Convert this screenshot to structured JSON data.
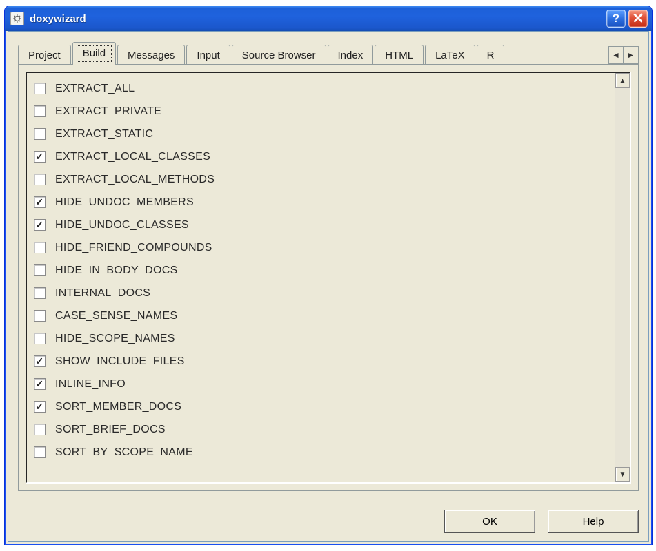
{
  "window": {
    "title": "doxywizard"
  },
  "tabs": [
    {
      "label": "Project",
      "active": false
    },
    {
      "label": "Build",
      "active": true
    },
    {
      "label": "Messages",
      "active": false
    },
    {
      "label": "Input",
      "active": false
    },
    {
      "label": "Source Browser",
      "active": false
    },
    {
      "label": "Index",
      "active": false
    },
    {
      "label": "HTML",
      "active": false
    },
    {
      "label": "LaTeX",
      "active": false
    },
    {
      "label": "R",
      "active": false
    }
  ],
  "options": [
    {
      "label": "EXTRACT_ALL",
      "checked": false
    },
    {
      "label": "EXTRACT_PRIVATE",
      "checked": false
    },
    {
      "label": "EXTRACT_STATIC",
      "checked": false
    },
    {
      "label": "EXTRACT_LOCAL_CLASSES",
      "checked": true
    },
    {
      "label": "EXTRACT_LOCAL_METHODS",
      "checked": false
    },
    {
      "label": "HIDE_UNDOC_MEMBERS",
      "checked": true
    },
    {
      "label": "HIDE_UNDOC_CLASSES",
      "checked": true
    },
    {
      "label": "HIDE_FRIEND_COMPOUNDS",
      "checked": false
    },
    {
      "label": "HIDE_IN_BODY_DOCS",
      "checked": false
    },
    {
      "label": "INTERNAL_DOCS",
      "checked": false
    },
    {
      "label": "CASE_SENSE_NAMES",
      "checked": false
    },
    {
      "label": "HIDE_SCOPE_NAMES",
      "checked": false
    },
    {
      "label": "SHOW_INCLUDE_FILES",
      "checked": true
    },
    {
      "label": "INLINE_INFO",
      "checked": true
    },
    {
      "label": "SORT_MEMBER_DOCS",
      "checked": true
    },
    {
      "label": "SORT_BRIEF_DOCS",
      "checked": false
    },
    {
      "label": "SORT_BY_SCOPE_NAME",
      "checked": false
    }
  ],
  "buttons": {
    "ok": "OK",
    "help": "Help"
  },
  "titlebar_buttons": {
    "help": "?",
    "close": "×"
  }
}
